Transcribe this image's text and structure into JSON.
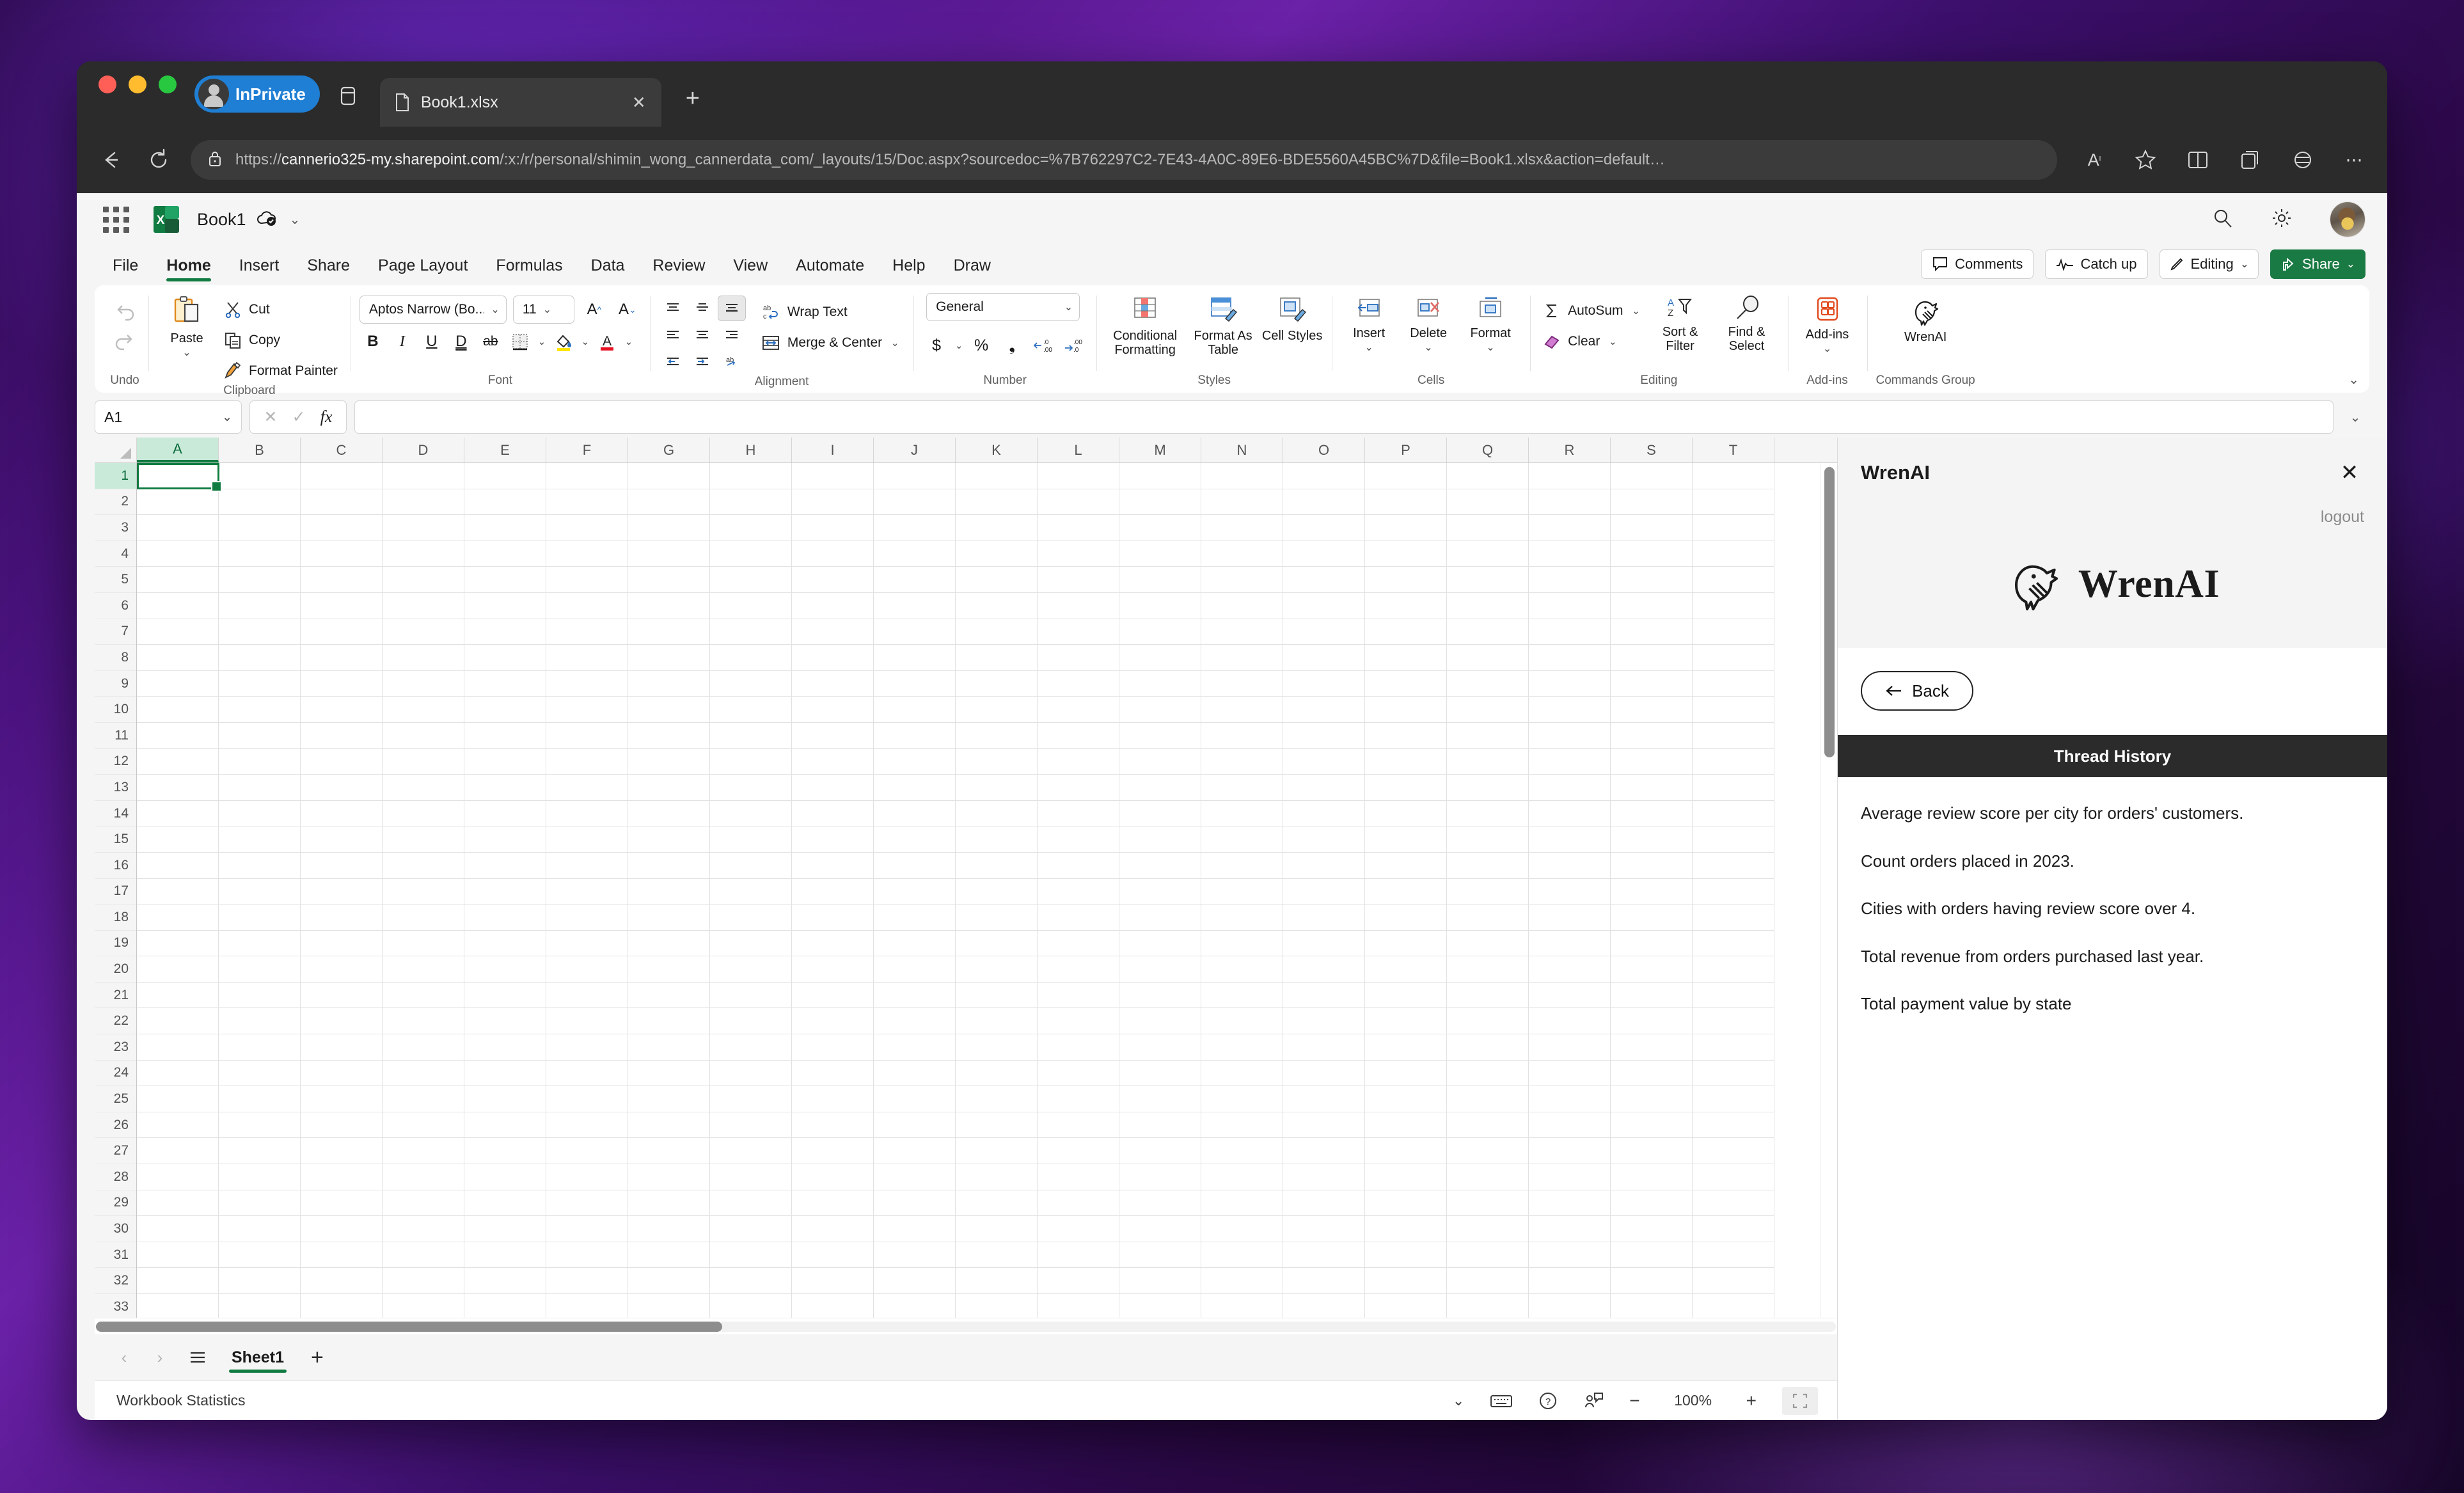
{
  "browser": {
    "profile_label": "InPrivate",
    "tab": {
      "title": "Book1.xlsx",
      "close_label": "✕"
    },
    "new_tab_label": "+",
    "url_prefix": "https://",
    "url_host": "cannerio325-my.sharepoint.com",
    "url_path": "/:x:/r/personal/shimin_wong_cannerdata_com/_layouts/15/Doc.aspx?sourcedoc=%7B762297C2-7E43-4A0C-89E6-BDE5560A45BC%7D&file=Book1.xlsx&action=default…"
  },
  "excel": {
    "doc_title": "Book1",
    "ribbon_tabs": [
      {
        "label": "File",
        "active": false
      },
      {
        "label": "Home",
        "active": true
      },
      {
        "label": "Insert",
        "active": false
      },
      {
        "label": "Share",
        "active": false
      },
      {
        "label": "Page Layout",
        "active": false
      },
      {
        "label": "Formulas",
        "active": false
      },
      {
        "label": "Data",
        "active": false
      },
      {
        "label": "Review",
        "active": false
      },
      {
        "label": "View",
        "active": false
      },
      {
        "label": "Automate",
        "active": false
      },
      {
        "label": "Help",
        "active": false
      },
      {
        "label": "Draw",
        "active": false
      }
    ],
    "header_actions": [
      {
        "label": "Comments"
      },
      {
        "label": "Catch up"
      },
      {
        "label": "Editing"
      },
      {
        "label": "Share"
      }
    ],
    "groups": {
      "undo": {
        "label": "Undo"
      },
      "clipboard": {
        "label": "Clipboard",
        "paste": "Paste",
        "cut": "Cut",
        "copy": "Copy",
        "format_painter": "Format Painter"
      },
      "font": {
        "label": "Font",
        "font_name": "Aptos Narrow (Bo...",
        "font_size": "11",
        "bold": "B",
        "italic": "I",
        "underline": "U",
        "double_underline": "D",
        "strikethrough": "ab"
      },
      "alignment": {
        "label": "Alignment",
        "wrap_text": "Wrap Text",
        "merge_center": "Merge & Center"
      },
      "number": {
        "label": "Number",
        "format": "General",
        "currency": "$",
        "percent": "%",
        "comma": "❟"
      },
      "styles": {
        "label": "Styles",
        "conditional_formatting": "Conditional Formatting",
        "format_as_table": "Format As Table",
        "cell_styles": "Cell Styles"
      },
      "cells": {
        "label": "Cells",
        "insert": "Insert",
        "delete": "Delete",
        "format": "Format"
      },
      "editing": {
        "label": "Editing",
        "autosum": "AutoSum",
        "clear": "Clear",
        "sort_filter": "Sort & Filter",
        "find_select": "Find & Select"
      },
      "addins": {
        "label": "Add-ins",
        "button": "Add-ins"
      },
      "commands": {
        "label": "Commands Group",
        "wrenai": "WrenAI"
      }
    },
    "formula_bar": {
      "name_box": "A1",
      "cancel": "✕",
      "confirm": "✓",
      "fx": "fx",
      "value": ""
    },
    "grid": {
      "columns": [
        "A",
        "B",
        "C",
        "D",
        "E",
        "F",
        "G",
        "H",
        "I",
        "J",
        "K",
        "L",
        "M",
        "N",
        "O",
        "P",
        "Q",
        "R",
        "S",
        "T"
      ],
      "rows": [
        1,
        2,
        3,
        4,
        5,
        6,
        7,
        8,
        9,
        10,
        11,
        12,
        13,
        14,
        15,
        16,
        17,
        18,
        19,
        20,
        21,
        22,
        23,
        24,
        25,
        26,
        27,
        28,
        29,
        30,
        31,
        32,
        33
      ],
      "selected_cell": "A1",
      "selected_column": "A",
      "selected_row": 1
    },
    "sheet_tabs": [
      {
        "label": "Sheet1",
        "active": true
      }
    ],
    "add_sheet_label": "+",
    "status": {
      "left": "Workbook Statistics",
      "zoom": "100%",
      "zoom_out": "−",
      "zoom_in": "+"
    }
  },
  "wren": {
    "panel_title": "WrenAI",
    "close_label": "✕",
    "logout_label": "logout",
    "logo_text": "WrenAI",
    "back_label": "Back",
    "thread_history_title": "Thread History",
    "thread_items": [
      "Average review score per city for orders' customers.",
      "Count orders placed in 2023.",
      "Cities with orders having review score over 4.",
      "Total revenue from orders purchased last year.",
      "Total payment value by state"
    ]
  },
  "colors": {
    "excel_green": "#107c41",
    "accent_blue": "#1f7fd4",
    "wren_dark": "#2b2b2b"
  }
}
